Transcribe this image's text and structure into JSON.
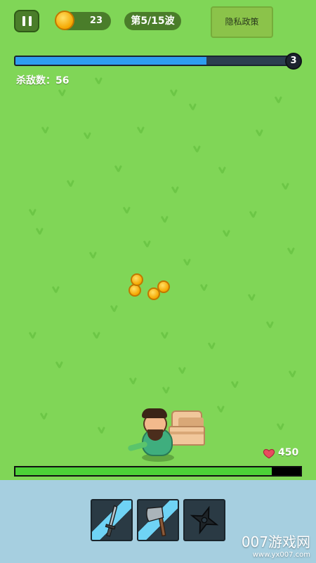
{
  "hud": {
    "coins": "23",
    "wave_label": "第5/15波",
    "privacy_label": "隐私政策",
    "wave_progress": 0.69,
    "level": "3",
    "kills_label": "杀敌数：",
    "kills_value": "56"
  },
  "player": {
    "hp_value": "450",
    "hp_fraction": 0.9
  },
  "weapons": [
    {
      "name": "sword",
      "icon": "sword-icon",
      "active": true
    },
    {
      "name": "axe",
      "icon": "axe-icon",
      "active": true
    },
    {
      "name": "shuriken",
      "icon": "shuriken-icon",
      "active": false
    }
  ],
  "watermark": {
    "main": "007游戏网",
    "sub": "www.yx007.com"
  },
  "colors": {
    "grass": "#80d657",
    "wave_fill": "#2e9df0",
    "hp_fill": "#4cd137",
    "panel": "#a6cfe0"
  }
}
